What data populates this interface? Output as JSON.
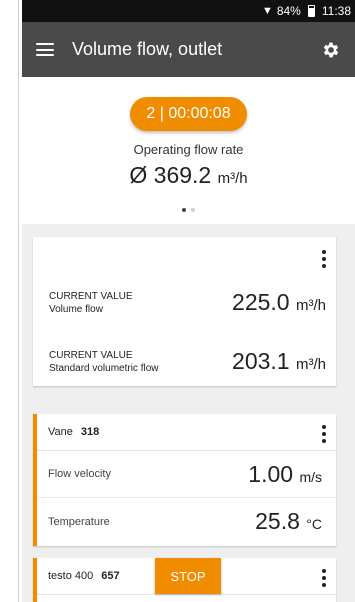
{
  "status_bar": {
    "wifi_icon": "wifi-icon",
    "battery": "84%",
    "time": "11:38"
  },
  "app_bar": {
    "menu_icon": "hamburger-menu-icon",
    "title": "Volume flow, outlet",
    "settings_icon": "gear-icon"
  },
  "summary": {
    "timer": "2 | 00:00:08",
    "label": "Operating flow rate",
    "value": "Ø 369.2",
    "unit": "m³/h",
    "pages": 2,
    "current_page": 1
  },
  "card_current": {
    "rows": [
      {
        "label": "CURRENT VALUE",
        "sublabel": "Volume flow",
        "value": "225.0",
        "unit": "m³/h"
      },
      {
        "label": "CURRENT VALUE",
        "sublabel": "Standard volumetric flow",
        "value": "203.1",
        "unit": "m³/h"
      }
    ]
  },
  "card_vane": {
    "probe": "Vane",
    "id": "318",
    "rows": [
      {
        "label": "Flow velocity",
        "value": "1.00",
        "unit": "m/s"
      },
      {
        "label": "Temperature",
        "value": "25.8",
        "unit": "°C"
      }
    ]
  },
  "card_testo": {
    "probe": "testo 400",
    "id": "657",
    "stop_label": "STOP"
  },
  "colors": {
    "accent": "#f08c00",
    "app_bar": "#4a4a4a",
    "status_bar": "#111111"
  }
}
